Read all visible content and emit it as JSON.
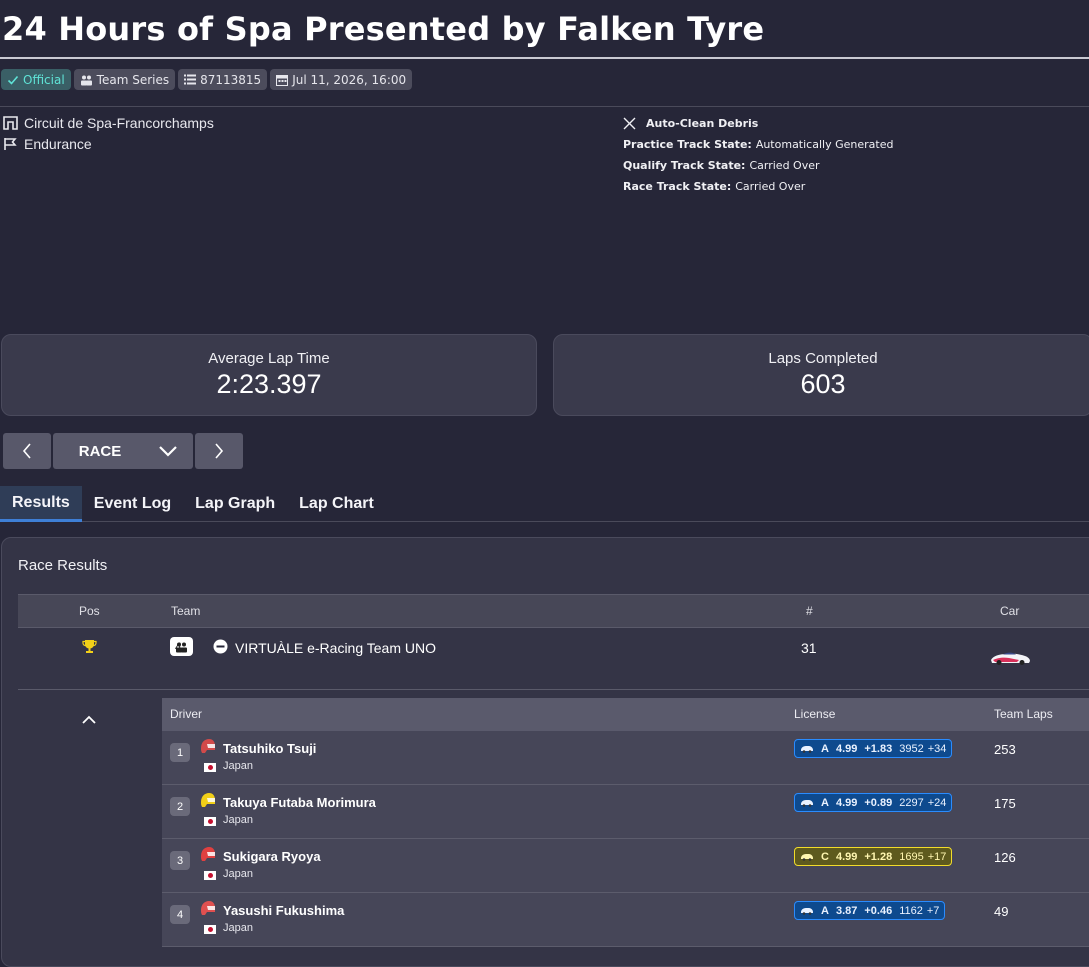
{
  "event": {
    "title": "24 Hours of Spa Presented by Falken Tyre",
    "badges": {
      "official": "Official",
      "series": "Team Series",
      "session_id": "87113815",
      "date": "Jul 11, 2026, 16:00"
    },
    "track": "Circuit de Spa-Francorchamps",
    "category": "Endurance",
    "conditions": {
      "auto_clean": "Auto-Clean Debris",
      "practice_label": "Practice Track State:",
      "practice_value": "Automatically Generated",
      "qualify_label": "Qualify Track State:",
      "qualify_value": "Carried Over",
      "race_label": "Race Track State:",
      "race_value": "Carried Over"
    }
  },
  "stats": {
    "avg_lap_label": "Average Lap Time",
    "avg_lap_value": "2:23.397",
    "laps_label": "Laps Completed",
    "laps_value": "603"
  },
  "session_nav": {
    "current": "RACE"
  },
  "tabs": [
    "Results",
    "Event Log",
    "Lap Graph",
    "Lap Chart"
  ],
  "results": {
    "title": "Race Results",
    "headers": {
      "pos": "Pos",
      "team": "Team",
      "number": "#",
      "car": "Car"
    },
    "team_row": {
      "driver_count": "4",
      "team_name": "VIRTUÀLE e-Racing Team UNO",
      "number": "31"
    },
    "driver_headers": {
      "driver": "Driver",
      "license": "License",
      "team_laps": "Team Laps"
    },
    "drivers": [
      {
        "index": "1",
        "name": "Tatsuhiko Tsuji",
        "country": "Japan",
        "class": "A",
        "sr": "4.99",
        "sr_delta": "+1.83",
        "ir": "3952",
        "ir_delta": "+34",
        "laps": "253",
        "license_color": "#2a8cff",
        "helmet_color": "#d24a4a"
      },
      {
        "index": "2",
        "name": "Takuya Futaba Morimura",
        "country": "Japan",
        "class": "A",
        "sr": "4.99",
        "sr_delta": "+0.89",
        "ir": "2297",
        "ir_delta": "+24",
        "laps": "175",
        "license_color": "#2a8cff",
        "helmet_color": "#f2d018"
      },
      {
        "index": "3",
        "name": "Sukigara Ryoya",
        "country": "Japan",
        "class": "C",
        "sr": "4.99",
        "sr_delta": "+1.28",
        "ir": "1695",
        "ir_delta": "+17",
        "laps": "126",
        "license_color": "#f2dc2a",
        "helmet_color": "#e04040"
      },
      {
        "index": "4",
        "name": "Yasushi Fukushima",
        "country": "Japan",
        "class": "A",
        "sr": "3.87",
        "sr_delta": "+0.46",
        "ir": "1162",
        "ir_delta": "+7",
        "laps": "49",
        "license_color": "#2a8cff",
        "helmet_color": "#e05050"
      }
    ]
  }
}
